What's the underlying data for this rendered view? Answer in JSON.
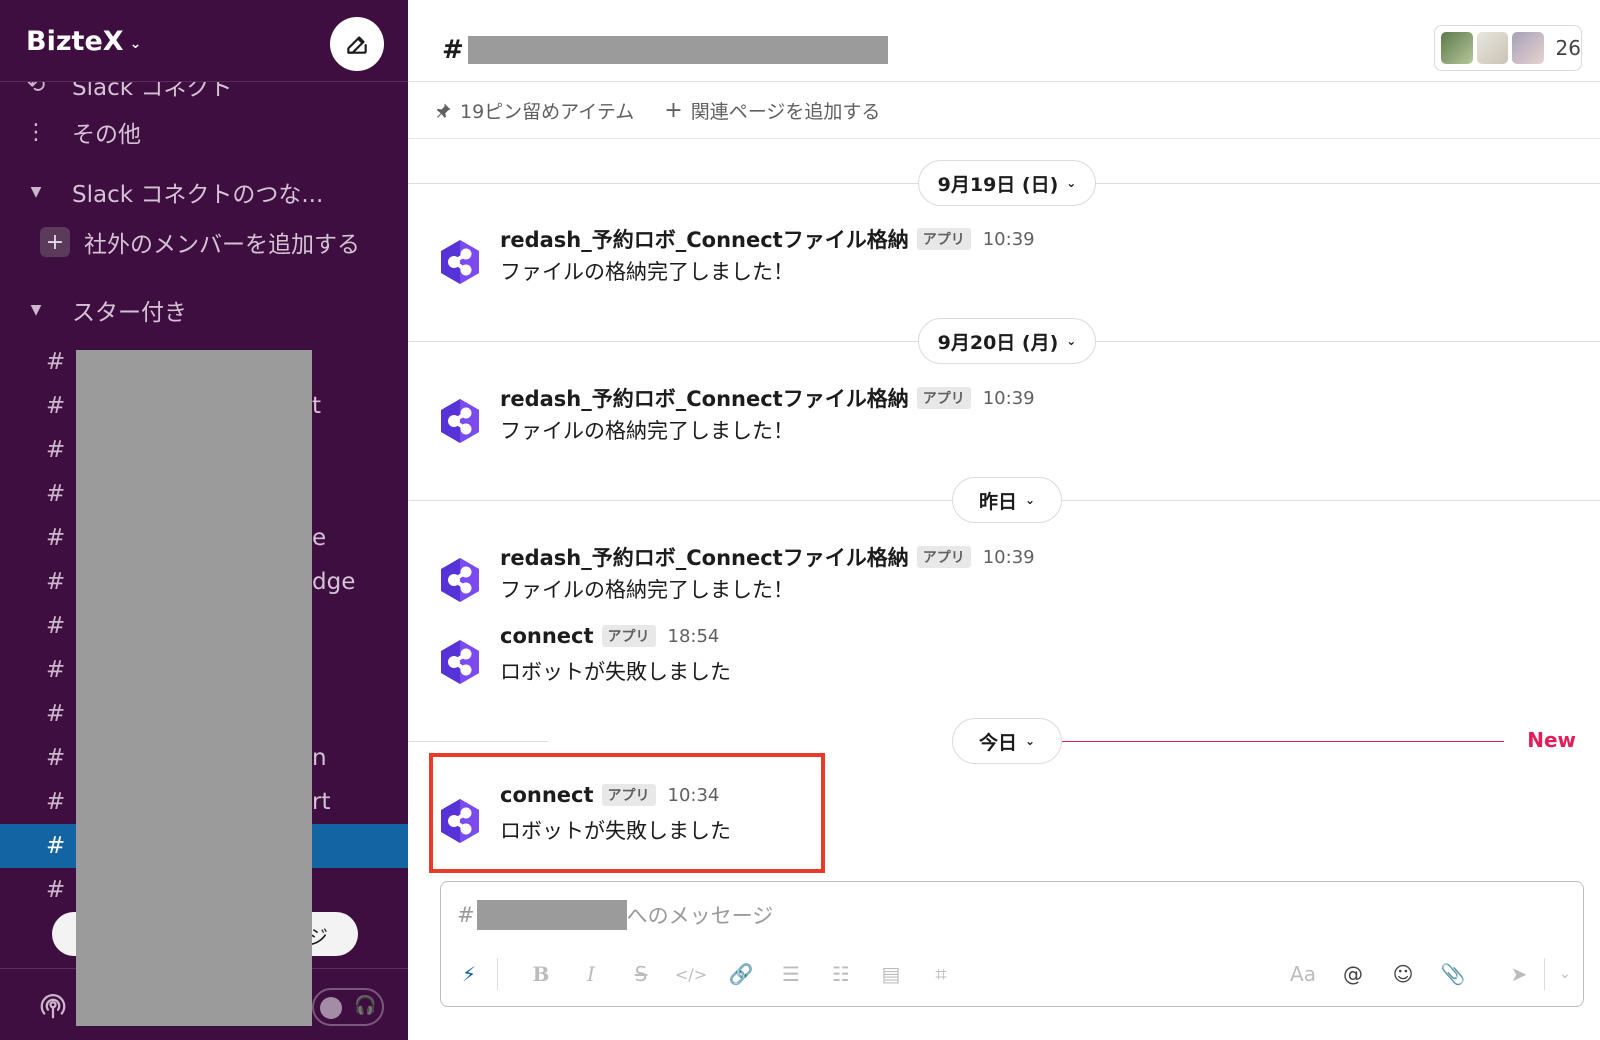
{
  "sidebar": {
    "workspace_name": "BizteX",
    "items": [
      {
        "icon": "slack-connect-icon",
        "label": "Slack コネクト"
      },
      {
        "icon": "more-vertical-icon",
        "label": "その他"
      }
    ],
    "connect_section": {
      "label": "Slack コネクトのつな..."
    },
    "add_external_label": "社外のメンバーを追加する",
    "starred_section": {
      "label": "スター付き"
    },
    "channel_hash": "#",
    "channel_suffixes": [
      "",
      "t",
      "",
      "",
      "e",
      "dge",
      "",
      "",
      "",
      "n",
      "rt",
      "",
      ""
    ],
    "huddle_right": "ジ"
  },
  "channel": {
    "hash": "#",
    "member_count": "26"
  },
  "bookmarks": {
    "pinned": "19ピン留めアイテム",
    "add_page": "関連ページを追加する"
  },
  "dates": {
    "sep19": "9月19日 (日)",
    "sep20": "9月20日 (月)",
    "yesterday": "昨日",
    "today": "今日",
    "new_label": "New"
  },
  "messages": [
    {
      "sender": "redash_予約ロボ_Connectファイル格納",
      "badge": "アプリ",
      "time": "10:39",
      "text": "ファイルの格納完了しました！"
    },
    {
      "sender": "redash_予約ロボ_Connectファイル格納",
      "badge": "アプリ",
      "time": "10:39",
      "text": "ファイルの格納完了しました！"
    },
    {
      "sender": "redash_予約ロボ_Connectファイル格納",
      "badge": "アプリ",
      "time": "10:39",
      "text": "ファイルの格納完了しました！"
    },
    {
      "sender": "connect",
      "badge": "アプリ",
      "time": "18:54",
      "text": "ロボットが失敗しました"
    },
    {
      "sender": "connect",
      "badge": "アプリ",
      "time": "10:34",
      "text": "ロボットが失敗しました"
    }
  ],
  "composer": {
    "hash": "#",
    "placeholder_suffix": "へのメッセージ",
    "font_label": "Aa"
  },
  "colors": {
    "sidebar_bg": "#3f0e40",
    "active_channel": "#1264a3",
    "new_line": "#e01e5a",
    "highlight": "#e8392b"
  }
}
